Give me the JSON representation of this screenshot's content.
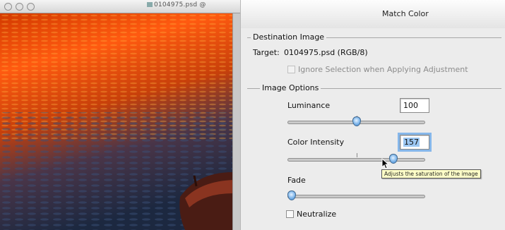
{
  "document": {
    "title": "0104975.psd @",
    "icon": "document-icon"
  },
  "dialog": {
    "title": "Match Color",
    "destination": {
      "heading": "Destination Image",
      "target_label": "Target:",
      "target_value": "0104975.psd (RGB/8)",
      "ignore_selection_label": "Ignore Selection when Applying Adjustment",
      "ignore_selection_checked": false
    },
    "image_options": {
      "heading": "Image Options",
      "luminance": {
        "label": "Luminance",
        "value": "100",
        "level_fraction": 0.5
      },
      "color_intensity": {
        "label": "Color Intensity",
        "value": "157",
        "level_fraction": 0.785
      },
      "fade": {
        "label": "Fade",
        "value": 0,
        "level_fraction": 0.0
      },
      "neutralize": {
        "label": "Neutralize",
        "checked": false
      }
    },
    "tooltip": "Adjusts the saturation of the image"
  },
  "colors": {
    "accent": "#3c84cf",
    "sunset_orange": "#ff6a1a",
    "water_blue": "#1b2638"
  }
}
